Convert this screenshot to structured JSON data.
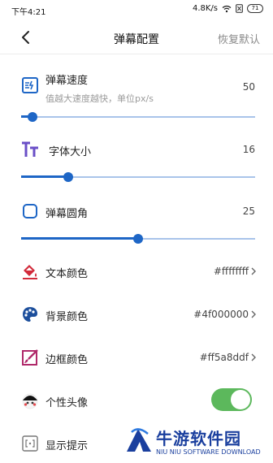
{
  "status_bar": {
    "time": "下午4:21",
    "net_speed": "4.8K/s",
    "battery": "71"
  },
  "header": {
    "title": "弹幕配置",
    "reset": "恢复默认"
  },
  "settings": {
    "speed": {
      "label": "弹幕速度",
      "hint": "值越大速度越快，单位px/s",
      "value": "50",
      "level": 0.05,
      "icon": "speed-icon"
    },
    "font_size": {
      "label": "字体大小",
      "value": "16",
      "level": 0.2,
      "icon": "font-size-icon"
    },
    "corner": {
      "label": "弹幕圆角",
      "value": "25",
      "level": 0.5,
      "icon": "rounded-square-icon"
    },
    "text_color": {
      "label": "文本颜色",
      "value": "#ffffffff",
      "icon": "paint-bucket-icon"
    },
    "bg_color": {
      "label": "背景颜色",
      "value": "#4f000000",
      "icon": "palette-icon"
    },
    "border_color": {
      "label": "边框颜色",
      "value": "#ff5a8ddf",
      "icon": "brush-frame-icon"
    },
    "avatar": {
      "label": "个性头像",
      "enabled": true,
      "icon": "avatar-face-icon"
    },
    "display_hint": {
      "label": "显示提示",
      "icon": "hint-icon"
    }
  },
  "watermark": {
    "brand": "牛游软件园",
    "brand_en": "NIU NIU SOFTWARE DOWNLOAD"
  },
  "colors": {
    "accent": "#1e66c6",
    "track": "#a9c4ea",
    "toggle_on": "#5cb85c"
  }
}
